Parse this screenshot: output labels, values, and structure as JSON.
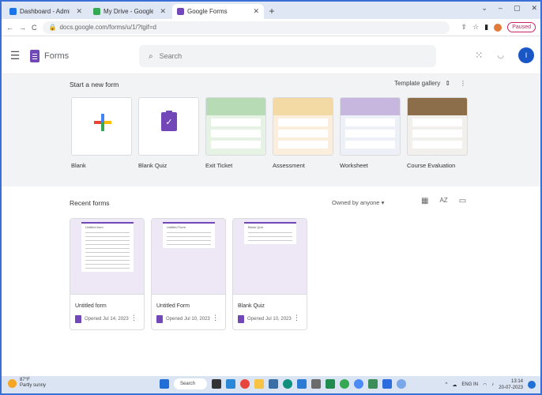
{
  "browser": {
    "tabs": [
      {
        "title": "Dashboard - Admin Console",
        "favicon_color": "#1a73e8",
        "active": false
      },
      {
        "title": "My Drive - Google Drive",
        "favicon_color": "#34a853",
        "active": false
      },
      {
        "title": "Google Forms",
        "favicon_color": "#7248b9",
        "active": true
      }
    ],
    "new_tab": "+",
    "window_controls": [
      "⌄",
      "–",
      "▢",
      "✕"
    ],
    "back": "←",
    "forward": "→",
    "reload": "C",
    "url": "docs.google.com/forms/u/1/?tgif=d",
    "paused_label": "Paused"
  },
  "app": {
    "name": "Forms",
    "search_placeholder": "Search",
    "menu_icon": "☰",
    "apps_icon": "⋮⋮⋮",
    "account_initial": "I"
  },
  "start": {
    "title": "Start a new form",
    "gallery_label": "Template gallery",
    "templates": [
      {
        "label": "Blank",
        "kind": "blank"
      },
      {
        "label": "Blank Quiz",
        "kind": "quiz"
      },
      {
        "label": "Exit Ticket",
        "kind": "template",
        "header_color": "#b7dcb5"
      },
      {
        "label": "Assessment",
        "kind": "template",
        "header_color": "#f3d9a4"
      },
      {
        "label": "Worksheet",
        "kind": "template",
        "header_color": "#c7b6de"
      },
      {
        "label": "Course Evaluation",
        "kind": "template",
        "header_color": "#8d6e4a"
      }
    ]
  },
  "recent": {
    "title": "Recent forms",
    "owner_filter": "Owned by anyone",
    "forms": [
      {
        "name": "Untitled form",
        "opened": "Opened Jul 14, 2023"
      },
      {
        "name": "Untitled Form",
        "opened": "Opened Jul 10, 2023"
      },
      {
        "name": "Blank Quiz",
        "opened": "Opened Jul 10, 2023"
      }
    ]
  },
  "taskbar": {
    "weather_temp": "87°F",
    "weather_desc": "Partly sunny",
    "search_label": "Search",
    "language": "ENG IN",
    "time": "13:14",
    "date": "20-07-2023"
  }
}
